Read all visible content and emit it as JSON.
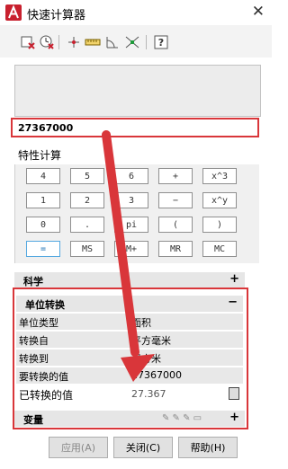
{
  "title_bar": {
    "title": "快速计算器",
    "close_icon": "close-icon"
  },
  "toolbar": {
    "icons": [
      "clear-icon",
      "clear-history-icon",
      "get-coordinates-icon",
      "distance-icon",
      "angle-icon",
      "intersection-icon",
      "help-icon"
    ]
  },
  "input": {
    "value": "27367000"
  },
  "properties_label": "特性计算",
  "keypad": {
    "rows": [
      [
        "4",
        "5",
        "6",
        "+",
        "x^3"
      ],
      [
        "1",
        "2",
        "3",
        "−",
        "x^y"
      ],
      [
        "0",
        ".",
        "pi",
        "(",
        ")"
      ],
      [
        "=",
        "MS",
        "M+",
        "MR",
        "MC"
      ]
    ]
  },
  "sections": {
    "science": {
      "label": "科学",
      "toggle": "+"
    },
    "unit_conversion": {
      "label": "单位转换",
      "toggle": "−"
    },
    "variables": {
      "label": "变量",
      "toggle": "+"
    }
  },
  "unit_conversion": {
    "rows": [
      {
        "label": "单位类型",
        "value": "面积"
      },
      {
        "label": "转换自",
        "value": "平方毫米"
      },
      {
        "label": "转换到",
        "value": "平方米"
      },
      {
        "label": "要转换的值",
        "value": "27367000"
      },
      {
        "label": "已转换的值",
        "value": "27.367"
      }
    ]
  },
  "footer": {
    "apply": "应用(A)",
    "close": "关闭(C)",
    "help": "帮助(H)"
  },
  "colors": {
    "highlight": "#d9363a",
    "arrow": "#d9363a",
    "accent": "#1a6fb3"
  }
}
